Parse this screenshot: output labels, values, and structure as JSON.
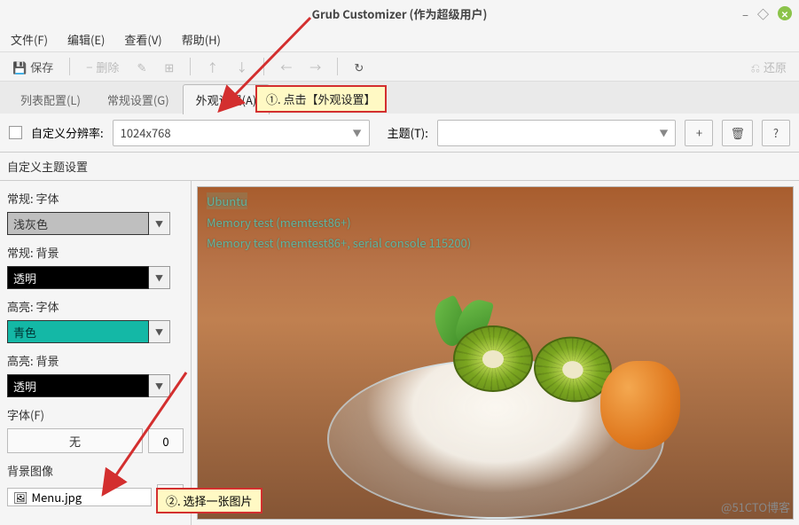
{
  "window": {
    "title": "Grub Customizer (作为超级用户)"
  },
  "menubar": {
    "file": "文件(F)",
    "edit": "编辑(E)",
    "view": "查看(V)",
    "help": "帮助(H)"
  },
  "toolbar": {
    "save": "保存",
    "delete": "删除",
    "restore": "还原"
  },
  "tabs": {
    "list": "列表配置(L)",
    "general": "常规设置(G)",
    "appearance": "外观设置(A)"
  },
  "annotations": {
    "step1": "①. 点击【外观设置】",
    "step2": "②. 选择一张图片"
  },
  "settings": {
    "custom_res_label": "自定义分辨率:",
    "resolution": "1024x768",
    "theme_label": "主题(T):",
    "theme_value": ""
  },
  "section_custom_theme": "自定义主题设置",
  "panel": {
    "normal_font_label": "常规: 字体",
    "normal_font_value": "浅灰色",
    "normal_bg_label": "常规: 背景",
    "normal_bg_value": "透明",
    "highlight_font_label": "高亮: 字体",
    "highlight_font_value": "青色",
    "highlight_bg_label": "高亮: 背景",
    "highlight_bg_value": "透明",
    "font_label": "字体(F)",
    "font_button": "无",
    "font_size": "0",
    "bg_image_label": "背景图像",
    "bg_file": "Menu.jpg"
  },
  "preview": {
    "line1": "Ubuntu",
    "line2": "Memory test (memtest86+)",
    "line3": "Memory test (memtest86+, serial console 115200)"
  },
  "watermark": "@51CTO博客",
  "colors": {
    "normal_font_swatch": "#bfbfbf",
    "normal_bg_swatch": "#000000",
    "highlight_font_swatch": "#14b8a6",
    "highlight_bg_swatch": "#000000"
  }
}
